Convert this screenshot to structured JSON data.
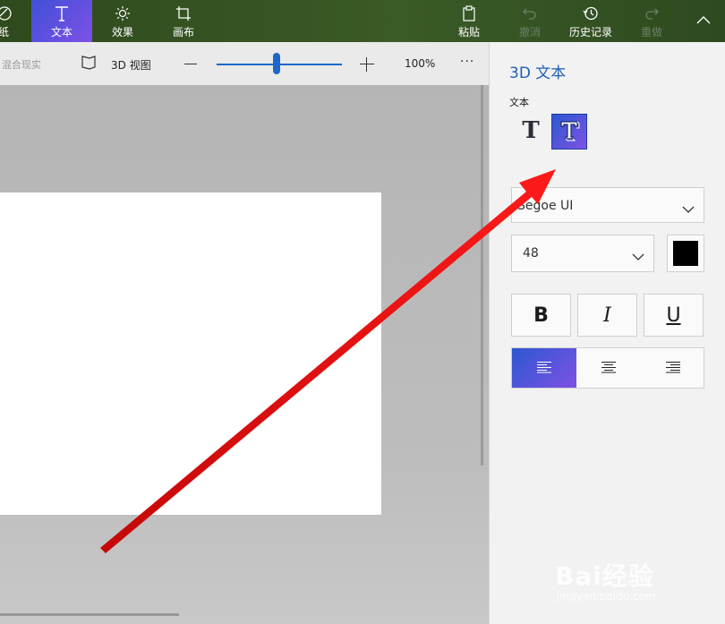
{
  "toolbar": {
    "tools": [
      {
        "id": "sticker",
        "label": "纸",
        "icon": "sticker-icon"
      },
      {
        "id": "text",
        "label": "文本",
        "icon": "text-icon"
      },
      {
        "id": "effects",
        "label": "效果",
        "icon": "sun-icon"
      },
      {
        "id": "canvas",
        "label": "画布",
        "icon": "crop-icon"
      }
    ],
    "actions": {
      "paste": "粘贴",
      "undo": "撤消",
      "history": "历史记录",
      "redo": "重做"
    }
  },
  "subbar": {
    "mixed_reality": "混合现实",
    "view_3d": "3D 视图",
    "zoom_percent": "100%",
    "zoom_level": 0.48,
    "more": "···"
  },
  "panel": {
    "title": "3D 文本",
    "text_label": "文本",
    "text_type_2d": "T",
    "font_name": "Segoe UI",
    "font_size": "48",
    "font_color": "#000000",
    "bold": "B",
    "italic": "I",
    "underline": "U"
  },
  "colors": {
    "accent": "#2d57d2",
    "accent_end": "#7d52e3",
    "toolbar_bg": "#3a5a27",
    "title_blue": "#2060b8",
    "annotation_arrow": "#e81010"
  },
  "watermark": {
    "brand": "Bai经验",
    "url": "jingyan.baidu.com"
  }
}
